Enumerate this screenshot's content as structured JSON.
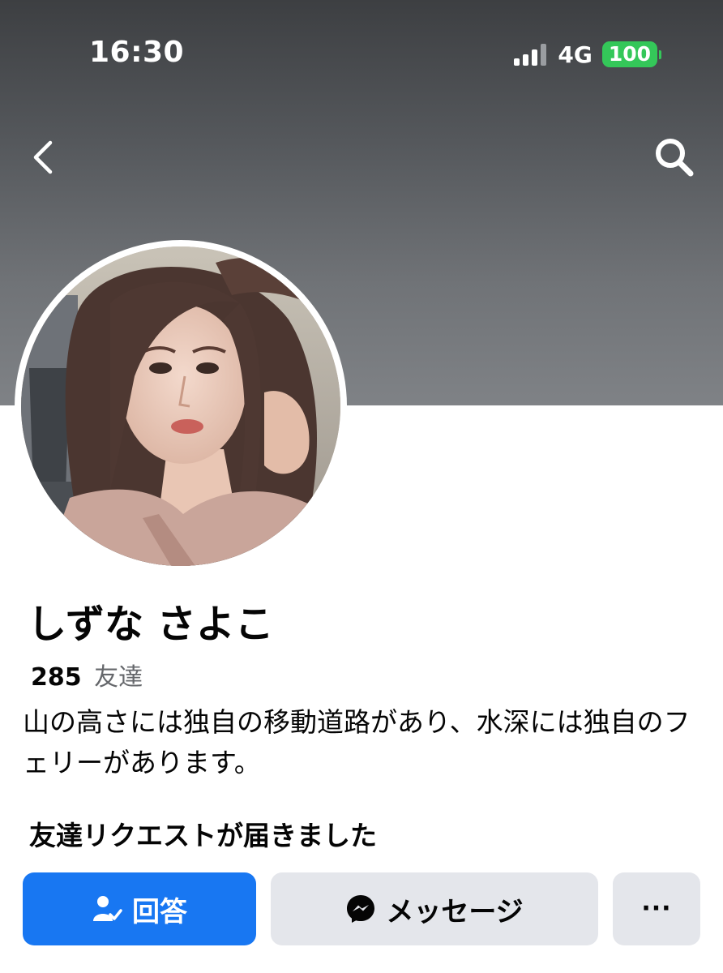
{
  "status_bar": {
    "time": "16:30",
    "network": "4G",
    "battery": "100"
  },
  "nav": {
    "back_icon": "chevron-left-icon",
    "search_icon": "search-icon"
  },
  "profile": {
    "name": "しずな さよこ",
    "friends_count": "285",
    "friends_label": "友達",
    "bio": "山の高さには独自の移動道路があり、水深には独自のフェリーがあります。"
  },
  "friend_request": {
    "title": "友達リクエストが届きました"
  },
  "actions": {
    "answer_label": "回答",
    "answer_icon": "person-check-icon",
    "message_label": "メッセージ",
    "message_icon": "messenger-icon",
    "more_label": "···"
  },
  "colors": {
    "primary_blue": "#1877f2",
    "secondary_gray": "#e4e6eb",
    "battery_green": "#34c759",
    "text_primary": "#050505",
    "text_secondary": "#65676b"
  }
}
